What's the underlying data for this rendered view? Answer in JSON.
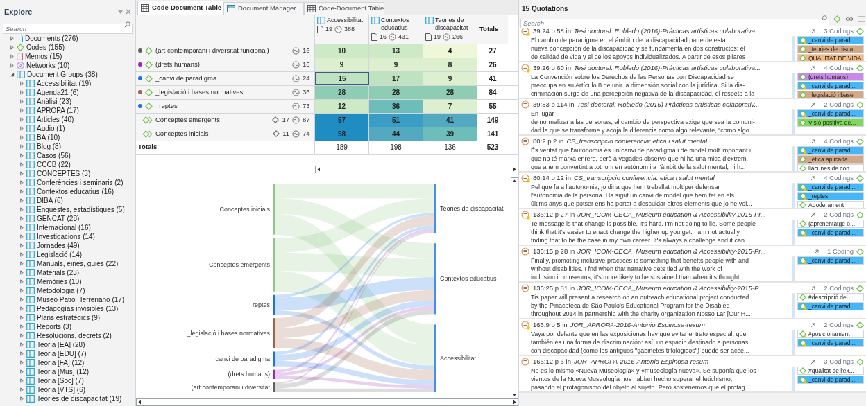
{
  "explore": {
    "title": "Explore",
    "search": {
      "placeholder": "Search"
    },
    "items": [
      {
        "kind": "documents",
        "label": "Documents (276)",
        "expanded": false
      },
      {
        "kind": "codes",
        "label": "Codes (155)",
        "expanded": false
      },
      {
        "kind": "memos",
        "label": "Memos (15)",
        "expanded": false
      },
      {
        "kind": "networks",
        "label": "Networks (10)",
        "expanded": false
      },
      {
        "kind": "document-group",
        "label": "Document Groups (38)",
        "expanded": true,
        "children": [
          {
            "kind": "document-group",
            "label": "Accessibilitat (19)",
            "expanded": false
          },
          {
            "kind": "document-group",
            "label": "Agenda21 (6)",
            "expanded": false
          },
          {
            "kind": "document-group",
            "label": "Anàlisi (23)",
            "expanded": false
          },
          {
            "kind": "document-group",
            "label": "APROPA (17)",
            "expanded": false
          },
          {
            "kind": "document-group",
            "label": "Articles (40)",
            "expanded": false
          },
          {
            "kind": "document-group",
            "label": "Audio (1)",
            "expanded": false
          },
          {
            "kind": "document-group",
            "label": "BA (10)",
            "expanded": false
          },
          {
            "kind": "document-group",
            "label": "Blog (8)",
            "expanded": false
          },
          {
            "kind": "document-group",
            "label": "Casos (56)",
            "expanded": false
          },
          {
            "kind": "document-group",
            "label": "CCCB (22)",
            "expanded": false
          },
          {
            "kind": "document-group",
            "label": "CONCEPTES (3)",
            "expanded": false
          },
          {
            "kind": "document-group",
            "label": "Conferències i seminaris (2)",
            "expanded": false
          },
          {
            "kind": "document-group",
            "label": "Contextos educatius (16)",
            "expanded": false
          },
          {
            "kind": "document-group",
            "label": "DIBA (6)",
            "expanded": false
          },
          {
            "kind": "document-group",
            "label": "Enquestes, estadístiques (5)",
            "expanded": false
          },
          {
            "kind": "document-group",
            "label": "GENCAT (28)",
            "expanded": false
          },
          {
            "kind": "document-group",
            "label": "Internacional (16)",
            "expanded": false
          },
          {
            "kind": "document-group",
            "label": "Investigacions (14)",
            "expanded": false
          },
          {
            "kind": "document-group",
            "label": "Jornades (49)",
            "expanded": false
          },
          {
            "kind": "document-group",
            "label": "Legislació (14)",
            "expanded": false
          },
          {
            "kind": "document-group",
            "label": "Manuals, eines, guies (22)",
            "expanded": false
          },
          {
            "kind": "document-group",
            "label": "Materials (23)",
            "expanded": false
          },
          {
            "kind": "document-group",
            "label": "Memòries (10)",
            "expanded": false
          },
          {
            "kind": "document-group",
            "label": "Metodologia (7)",
            "expanded": false
          },
          {
            "kind": "document-group",
            "label": "Museo Patio Herreriano (17)",
            "expanded": false
          },
          {
            "kind": "document-group",
            "label": "Pedagogías invisibles (13)",
            "expanded": false
          },
          {
            "kind": "document-group",
            "label": "Plans estratègics (9)",
            "expanded": false
          },
          {
            "kind": "document-group",
            "label": "Reports (3)",
            "expanded": false
          },
          {
            "kind": "document-group",
            "label": "Resolucions, decrets (2)",
            "expanded": false
          },
          {
            "kind": "document-group",
            "label": "Teoria [EA] (28)",
            "expanded": false
          },
          {
            "kind": "document-group",
            "label": "Teoria [EDU] (7)",
            "expanded": false
          },
          {
            "kind": "document-group",
            "label": "Teoria [FA] (12)",
            "expanded": false
          },
          {
            "kind": "document-group",
            "label": "Teoria [Mus] (12)",
            "expanded": false
          },
          {
            "kind": "document-group",
            "label": "Teoria [Soc] (7)",
            "expanded": false
          },
          {
            "kind": "document-group",
            "label": "Teoria [VTS] (6)",
            "expanded": false
          },
          {
            "kind": "document-group",
            "label": "Teories de discapacitat (19)",
            "expanded": false
          }
        ]
      }
    ]
  },
  "tabs": [
    {
      "kind": "table",
      "label": "Code-Document Table",
      "selected": true
    },
    {
      "kind": "manager",
      "label": "Document Manager",
      "selected": false
    },
    {
      "kind": "table",
      "label": "Code-Document Table",
      "selected": false
    }
  ],
  "table": {
    "columns": [
      {
        "name": "Accessibilitat",
        "documents": "19",
        "quotations": "388"
      },
      {
        "name": "Contextos educatius",
        "documents": "16",
        "quotations": "431"
      },
      {
        "name": "Teories de discapacitat",
        "documents": "19",
        "quotations": "266"
      }
    ],
    "totals_heading": "Totals",
    "rows": [
      {
        "kind": "code",
        "color": "#616161",
        "label": "(art contemporani i diversitat funcional)",
        "quotations": "16",
        "cells": [
          {
            "value": "10",
            "selected": false
          },
          {
            "value": "13",
            "selected": false
          },
          {
            "value": "4",
            "selected": false
          }
        ],
        "total": "27"
      },
      {
        "kind": "code",
        "color": "#9c27b0",
        "label": "(drets humans)",
        "quotations": "16",
        "cells": [
          {
            "value": "9",
            "selected": false
          },
          {
            "value": "9",
            "selected": false
          },
          {
            "value": "8",
            "selected": false
          }
        ],
        "total": "26"
      },
      {
        "kind": "code",
        "color": "#1a73e8",
        "label": "_canvi de paradigma",
        "quotations": "24",
        "cells": [
          {
            "value": "15",
            "selected": true
          },
          {
            "value": "17",
            "selected": false
          },
          {
            "value": "9",
            "selected": false
          }
        ],
        "total": "41"
      },
      {
        "kind": "code",
        "color": "#a0644a",
        "label": "_legislació i bases normatives",
        "quotations": "36",
        "cells": [
          {
            "value": "28",
            "selected": false
          },
          {
            "value": "28",
            "selected": false
          },
          {
            "value": "28",
            "selected": false
          }
        ],
        "total": "84"
      },
      {
        "kind": "code",
        "color": "#1a73e8",
        "label": "_reptes",
        "quotations": "73",
        "cells": [
          {
            "value": "12",
            "selected": false
          },
          {
            "value": "36",
            "selected": false
          },
          {
            "value": "7",
            "selected": false
          }
        ],
        "total": "55"
      },
      {
        "kind": "code-group",
        "label": "Conceptes emergents",
        "codes": "17",
        "quotations": "87",
        "cells": [
          {
            "value": "57",
            "selected": false
          },
          {
            "value": "51",
            "selected": false
          },
          {
            "value": "41",
            "selected": false
          }
        ],
        "total": "149"
      },
      {
        "kind": "code-group",
        "label": "Conceptes inicials",
        "codes": "11",
        "quotations": "74",
        "cells": [
          {
            "value": "58",
            "selected": false
          },
          {
            "value": "44",
            "selected": false
          },
          {
            "value": "39",
            "selected": false
          }
        ],
        "total": "141"
      }
    ],
    "totals": {
      "label": "Totals",
      "values": [
        "189",
        "198",
        "136"
      ],
      "total": "523"
    }
  },
  "sankey": {
    "left_nodes": [
      {
        "label": "Conceptes inicials",
        "color": "#8dc78a"
      },
      {
        "label": "Conceptes emergents",
        "color": "#8dc78a"
      },
      {
        "label": "_reptes",
        "color": "#1a73e8"
      },
      {
        "label": "_legislació i bases normatives",
        "color": "#a0644a"
      },
      {
        "label": "_canvi de paradigma",
        "color": "#1a73e8"
      },
      {
        "label": "(drets humans)",
        "color": "#9c27b0"
      },
      {
        "label": "(art contemporani i diversitat",
        "color": "#616161"
      }
    ],
    "right_nodes": [
      {
        "label": "Teories de discapacitat"
      },
      {
        "label": "Contextos educatius"
      },
      {
        "label": "Accessibilitat"
      }
    ]
  },
  "quotations": {
    "title": "15 Quotations",
    "search": {
      "placeholder": "Search"
    },
    "items": [
      {
        "ref": "39:24 p 58 in",
        "document": "Tesi doctoral: Robledo (2016)-Prácticas artísticas colaborativa...",
        "commented": true,
        "codings": "3 Codings",
        "lines": [
          "El cambio de paradigma en el ámbito de la discapacidad parte de esta",
          "nueva concepción de la discapacidad y se fundamenta en dos constructos: el",
          "de calidad de vida y el de los apoyos individualizados. A partir de esos pilares"
        ],
        "tags": [
          {
            "label": "_canvi de paradi...",
            "color": "#45b6f7",
            "commented": true
          },
          {
            "label": "_teories de disca...",
            "color": "#d4a886",
            "commented": false
          },
          {
            "label": "QUALITAT DE VIDA",
            "color": "#fbb87c",
            "commented": false
          }
        ]
      },
      {
        "ref": "39:26 p 60 in",
        "document": "Tesi doctoral: Robledo (2016)-Prácticas artísticas colaborativa...",
        "commented": true,
        "codings": "4 Codings",
        "lines": [
          "La Convención sobre los Derechos de las Personas con Discapacidad se",
          "preocupa en su Artículo 8 de unir la dimensión social con la jurídica. Si la dis-",
          "criminación surge de una percepción negativa de la discapacidad, el respeto a la"
        ],
        "tags": [
          {
            "label": "(drets humans)",
            "color": "#c98ae8",
            "commented": false
          },
          {
            "label": "_canvi de paradi...",
            "color": "#45b6f7",
            "commented": true
          },
          {
            "label": "_legislació i base",
            "color": "#d4a886",
            "commented": false
          }
        ]
      },
      {
        "ref": "39:83 p 114 in",
        "document": "Tesi doctoral: Robledo (2016)-Prácticas artísticas colaborativ...",
        "commented": false,
        "codings": "2 Codings",
        "lines": [
          "En lugar",
          "de normalizar a las personas, el cambio de perspectiva exige que sea la comuni-",
          "dad la que se transforme y acoja la diferencia como algo relevante, \"como algo"
        ],
        "tags": [
          {
            "label": "_canvi de paradi...",
            "color": "#45b6f7",
            "commented": true
          },
          {
            "label": "Visió positiva de...",
            "color": "#7fd95a",
            "commented": false
          }
        ]
      },
      {
        "ref": "80:2 p 2 in",
        "document": "CS_transcripcio conferencia: etica i salut mental",
        "commented": false,
        "codings": "4 Codings",
        "lines": [
          "És veritat que l'autonomia és un canvi de paradigma i de model molt important i",
          "que no té marxa enrere, però a vegades observo que hi ha una mica d'extrem,",
          "que anem convertint a tothom en autònom i a l'àmbit de la salut mental, hi h..."
        ],
        "tags": [
          {
            "label": "_canvi de paradi...",
            "color": "#45b6f7",
            "commented": true
          },
          {
            "label": "_ètica aplicada",
            "color": "#d4a886",
            "commented": false
          },
          {
            "label": "llacunes de con",
            "color": "#ffffff",
            "commented": false
          }
        ]
      },
      {
        "ref": "80:14 p 12 in",
        "document": "CS_transcripcio conferencia: etica i salut mental",
        "commented": true,
        "codings": "4 Codings",
        "lines": [
          "Pel que fa a l'autonomia, jo diria que hem treballat molt per defensar",
          "l'autonomia de la persona. Ha sigut un canvi de model que hem fet en els",
          "últims anys que potser ens ha portat a descuidar altres elements que jo he vol..."
        ],
        "tags": [
          {
            "label": "_canvi de paradi...",
            "color": "#45b6f7",
            "commented": true
          },
          {
            "label": "_reptes",
            "color": "#45b6f7",
            "commented": true
          },
          {
            "label": "Apoderament",
            "color": "#ffffff",
            "commented": false
          }
        ]
      },
      {
        "ref": "136:12 p 27 in",
        "document": "JOR_ICOM-CECA_Museum education & Accessibility-2015-Pr...",
        "commented": true,
        "codings": "2 Codings",
        "lines": [
          "Te message is that change is possible. It's hard. I'm not going to lie. Some people",
          "think that it's easier to enact change the higher up you get. I am not actually",
          "fnding that to be the case in my own career. It's always a challenge and it can..."
        ],
        "tags": [
          {
            "label": "(aprenentatge o...",
            "color": "#ffffff",
            "commented": false
          },
          {
            "label": "_canvi de paradi...",
            "color": "#45b6f7",
            "commented": true
          }
        ]
      },
      {
        "ref": "136:15 p 28 in",
        "document": "JOR_ICOM-CECA_Museum education & Accessibility-2015-Pr...",
        "commented": false,
        "codings": "1 Coding",
        "lines": [
          "Finally, promoting inclusive practices is something that benefts people with and",
          "without disabilities. I fnd when that narrative gets tied with the work of",
          "inclusion in museums, it's more likely to be sustained than when it's thought..."
        ],
        "tags": [
          {
            "label": "_canvi de paradi...",
            "color": "#45b6f7",
            "commented": true
          }
        ]
      },
      {
        "ref": "136:25 p 81 in",
        "document": "JOR_ICOM-CECA_Museum education & Accessibility-2015-P...",
        "commented": false,
        "codings": "2 Codings",
        "lines": [
          "Tis paper will present a research on an outreach educational project conducted",
          "by the Pinacoteca de São Paulo's Educational Program for the Disabled",
          "throughout 2014 in partnership with the charity organization Nosso Lar [Our H..."
        ],
        "tags": [
          {
            "label": "#descripció del...",
            "color": "#ffffff",
            "commented": false
          },
          {
            "label": "_canvi de paradi...",
            "color": "#45b6f7",
            "commented": true
          }
        ]
      },
      {
        "ref": "166:9 p 5 in",
        "document": "JOR_APROPA-2016-Antonio Espinosa-resum",
        "commented": true,
        "codings": "2 Codings",
        "lines": [
          "Vaya por delante que en las exposiciones hay que evitar el trato especial, que",
          "también es una forma de discriminación: así, un espacio destinado a personas",
          "con discapacidad (como los antiguos \"gabinetes tiflológicos\") puede ser acce..."
        ],
        "tags": [
          {
            "label": "#posicionament",
            "color": "#ffffff",
            "commented": true
          },
          {
            "label": "_canvi de paradi...",
            "color": "#45b6f7",
            "commented": true
          }
        ]
      },
      {
        "ref": "166:12 p 6 in",
        "document": "JOR_APROPA-2016-Antonio Espinosa-resum",
        "commented": false,
        "codings": "3 Codings",
        "lines": [
          "No es lo mismo «Nueva Museología» y «museología nueva». Se suponía que los",
          "vientos de la Nueva Museología nos habían hecho superar el fetichismo,",
          "pasando el protagonismo del objeto al sujeto. Pero sostenemos que el protag..."
        ],
        "tags": [
          {
            "label": "#qualitat de l'ex...",
            "color": "#ffffff",
            "commented": false
          },
          {
            "label": "_canvi de paradi...",
            "color": "#45b6f7",
            "commented": true
          }
        ]
      }
    ]
  }
}
